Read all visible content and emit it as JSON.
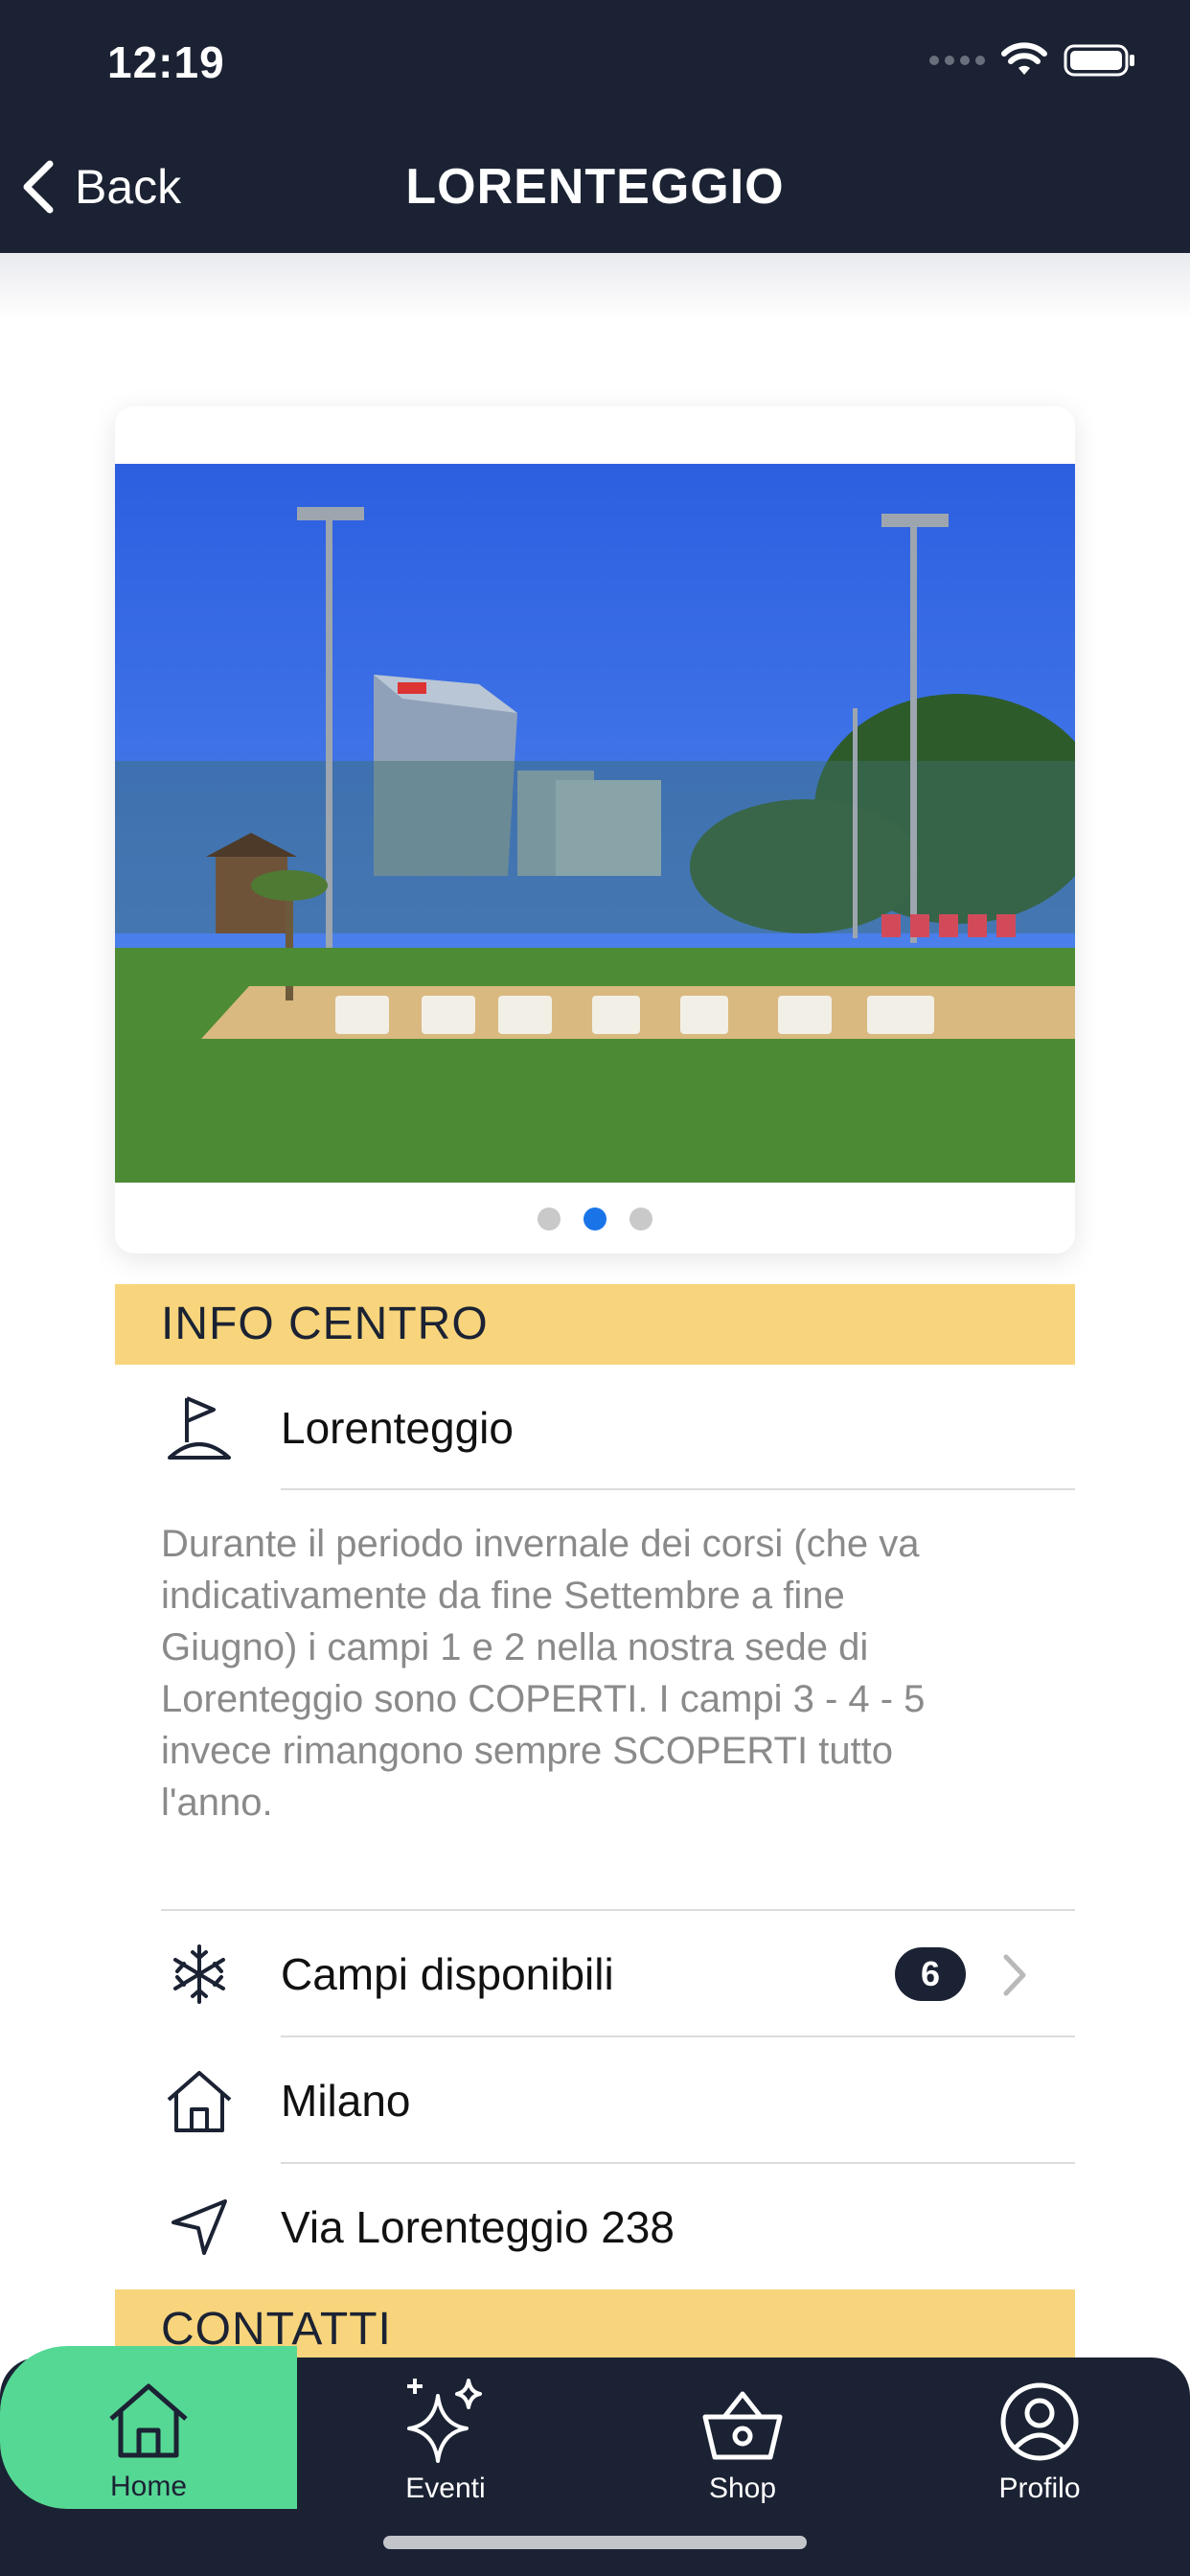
{
  "status_bar": {
    "time": "12:19"
  },
  "nav": {
    "back_label": "Back",
    "title": "LORENTEGGIO"
  },
  "gallery": {
    "page_count": 3,
    "active_page": 2
  },
  "info_section": {
    "title": "INFO CENTRO",
    "center_name": "Lorenteggio",
    "description": "Durante il periodo invernale dei corsi (che va indicativamente da fine Settembre a fine Giugno) i campi 1 e 2 nella nostra sede di Lorenteggio sono COPERTI. I campi 3 - 4 - 5 invece rimangono sempre SCOPERTI tutto l'anno.",
    "courts_label": "Campi disponibili",
    "courts_count": "6",
    "city": "Milano",
    "address": "Via Lorenteggio 238"
  },
  "contacts_section": {
    "title": "CONTATTI"
  },
  "tabbar": {
    "tabs": [
      {
        "label": "Home",
        "icon": "home-icon",
        "active": true
      },
      {
        "label": "Eventi",
        "icon": "sparkles-icon",
        "active": false
      },
      {
        "label": "Shop",
        "icon": "basket-icon",
        "active": false
      },
      {
        "label": "Profilo",
        "icon": "profile-icon",
        "active": false
      }
    ]
  },
  "colors": {
    "header_bg": "#1b2233",
    "section_band": "#f8d57c",
    "active_tab": "#56d895",
    "active_dot": "#1a74e8"
  }
}
